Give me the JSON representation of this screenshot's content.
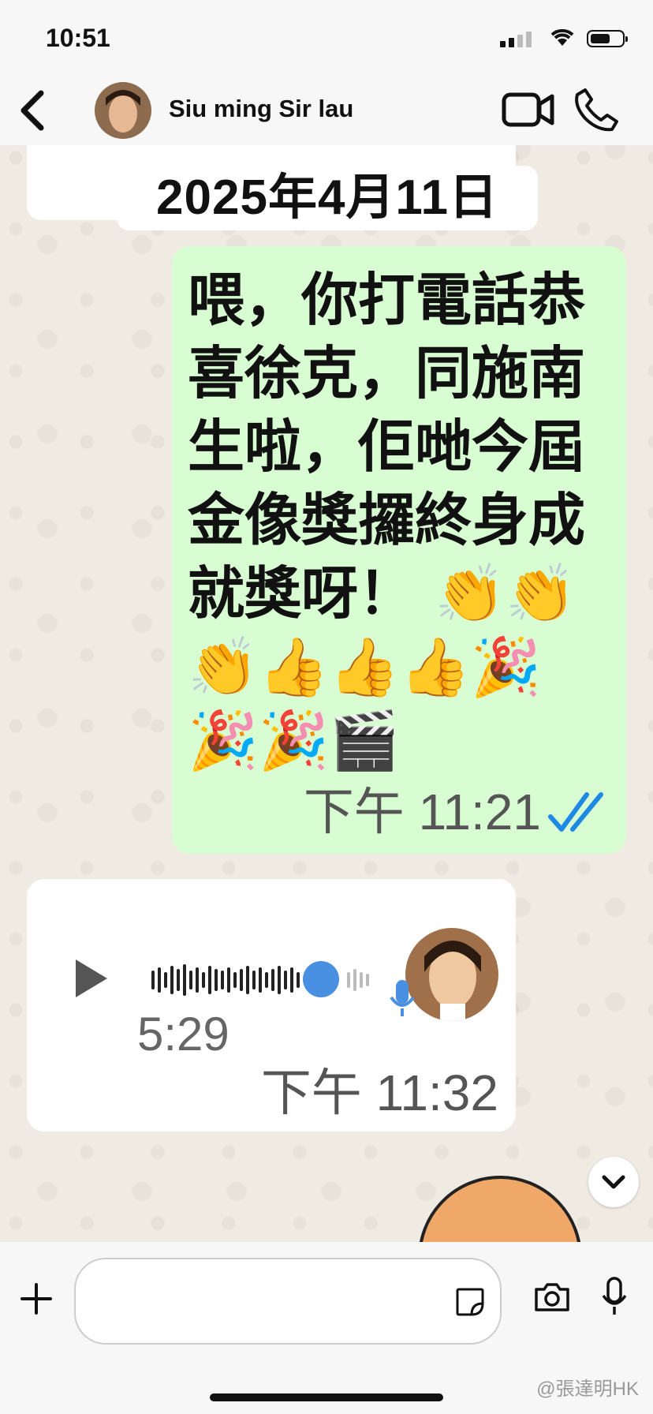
{
  "status_bar": {
    "time": "10:51"
  },
  "header": {
    "contact_name": "Siu ming Sir lau"
  },
  "date_separator": "2025年4月11日",
  "messages": [
    {
      "type": "text",
      "direction": "outgoing",
      "text": "喂，你打電話恭喜徐克，同施南生啦，佢哋今屆金像獎攞終身成就獎呀！ 👏👏👏👍👍👍🎉🎉🎉🎬",
      "time": "下午 11:21",
      "status": "read",
      "tick_color": "#1e88e5"
    },
    {
      "type": "voice",
      "direction": "incoming",
      "duration": "5:29",
      "time": "下午 11:32",
      "progress": 0.78
    }
  ],
  "composer": {
    "placeholder": ""
  },
  "watermark": "@張達明HK"
}
